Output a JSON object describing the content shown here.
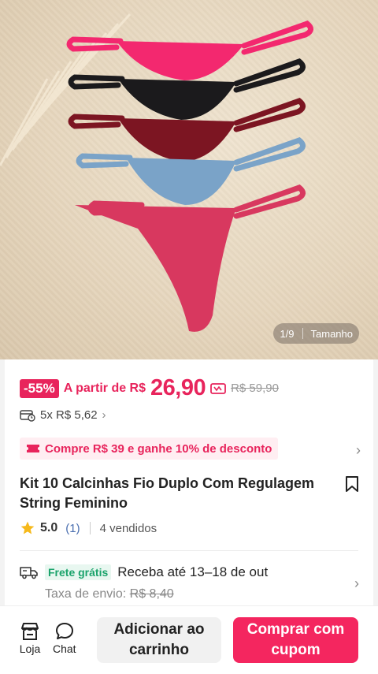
{
  "gallery": {
    "index": "1/9",
    "size_label": "Tamanho",
    "panty_colors": [
      "#f3286f",
      "#1b1a1c",
      "#7c1522",
      "#7aa3c8",
      "#d8385f"
    ]
  },
  "pricing": {
    "discount": "-55%",
    "from_label": "A partir de R$",
    "price": "26,90",
    "original": "R$ 59,90",
    "installments": "5x R$ 5,62",
    "promo": "Compre R$ 39 e ganhe 10% de desconto"
  },
  "product": {
    "title": "Kit 10 Calcinhas Fio Duplo Com Regulagem String Feminino",
    "rating": "5.0",
    "rating_count": "(1)",
    "sold": "4 vendidos"
  },
  "shipping": {
    "badge": "Frete grátis",
    "eta": "Receba até 13–18 de out",
    "fee_label": "Taxa de envio:",
    "fee_value": "R$ 8,40"
  },
  "bottom_bar": {
    "store": "Loja",
    "chat": "Chat",
    "add_to_cart": "Adicionar ao carrinho",
    "buy": "Comprar com cupom"
  },
  "colors": {
    "accent": "#e8245c",
    "buy_button": "#f4265f",
    "free_ship": "#1aa36b"
  }
}
